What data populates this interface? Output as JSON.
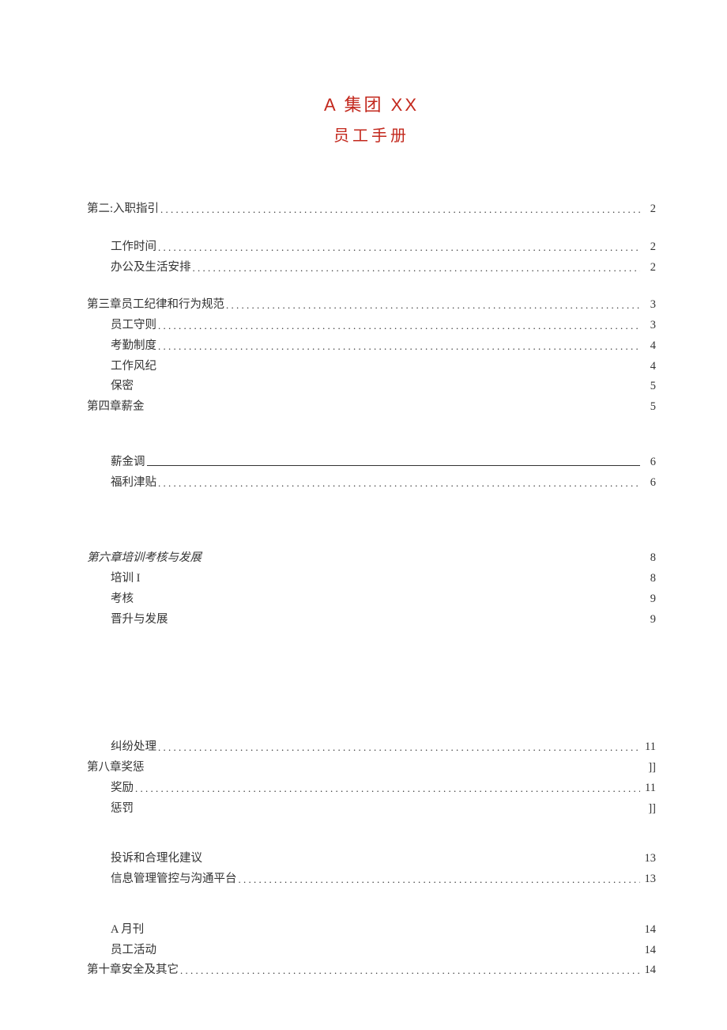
{
  "title": {
    "line1": "A 集团 XX",
    "line2": "员工手册"
  },
  "toc": [
    {
      "label": "第二:入职指引",
      "page": "2",
      "indent": 0,
      "leader": "dots",
      "gapAfter": 22
    },
    {
      "label": "工作时间",
      "page": "2",
      "indent": 1,
      "leader": "dots"
    },
    {
      "label": "办公及生活安排",
      "page": "2",
      "indent": 1,
      "leader": "dots",
      "gapAfter": 22
    },
    {
      "label": "第三章员工纪律和行为规范",
      "page": "3",
      "indent": 0,
      "leader": "dots"
    },
    {
      "label": "员工守则",
      "page": "3",
      "indent": 1,
      "leader": "dots"
    },
    {
      "label": "考勤制度",
      "page": "4",
      "indent": 1,
      "leader": "dots"
    },
    {
      "label": "工作风纪",
      "page": "4",
      "indent": 1,
      "leader": "none"
    },
    {
      "label": "保密",
      "page": "5",
      "indent": 1,
      "leader": "none"
    },
    {
      "label": "第四章薪金",
      "page": "5",
      "indent": 0,
      "leader": "none",
      "gapAfter": 44
    },
    {
      "label": "薪金调",
      "page": "6",
      "indent": 1,
      "leader": "underline"
    },
    {
      "label": "福利津贴",
      "page": "6",
      "indent": 1,
      "leader": "dots",
      "gapAfter": 70
    },
    {
      "label": "第六章培训考核与发展",
      "page": "8",
      "indent": 0,
      "leader": "none",
      "style": "italic"
    },
    {
      "label": "培训 I",
      "page": "8",
      "indent": 1,
      "leader": "none"
    },
    {
      "label": "考核",
      "page": "9",
      "indent": 1,
      "leader": "none"
    },
    {
      "label": "晋升与发展",
      "page": "9",
      "indent": 1,
      "leader": "none",
      "gapAfter": 136
    },
    {
      "label": "纠纷处理",
      "page": "11",
      "indent": 1,
      "leader": "dots"
    },
    {
      "label": "第八章奖惩",
      "page": "]]",
      "indent": 0,
      "leader": "none"
    },
    {
      "label": "奖励",
      "page": "11",
      "indent": 1,
      "leader": "dots"
    },
    {
      "label": "惩罚",
      "page": "]]",
      "indent": 1,
      "leader": "none",
      "gapAfter": 38
    },
    {
      "label": "投诉和合理化建议",
      "page": "13",
      "indent": 1,
      "leader": "none"
    },
    {
      "label": "信息管理管控与沟通平台",
      "page": "13",
      "indent": 1,
      "leader": "dots",
      "gapAfter": 38
    },
    {
      "label": "A 月刊",
      "page": "14",
      "indent": 1,
      "leader": "none"
    },
    {
      "label": "员工活动",
      "page": "14",
      "indent": 1,
      "leader": "none"
    },
    {
      "label": "第十章安全及其它",
      "page": "14",
      "indent": 0,
      "leader": "dots"
    }
  ]
}
